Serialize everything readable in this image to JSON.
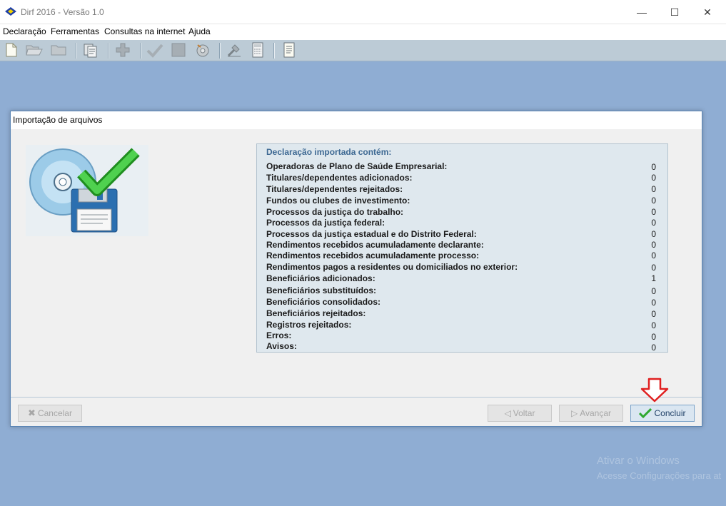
{
  "window": {
    "title": "Dirf 2016 - Versão 1.0"
  },
  "menu": [
    "Declaração",
    "Ferramentas",
    "Consultas na internet",
    "Ajuda"
  ],
  "toolbar": {
    "icons": [
      "new-document-icon",
      "open-folder-icon",
      "folder-icon",
      "copy-pages-icon",
      "add-icon",
      "check-icon",
      "stop-icon",
      "search-icon",
      "edit-icon",
      "calculator-icon",
      "report-icon"
    ]
  },
  "dialog": {
    "title": "Importação de arquivos",
    "summary_title": "Declaração importada contém:",
    "rows": [
      {
        "label": "Operadoras de Plano de Saúde Empresarial:",
        "value": "0"
      },
      {
        "label": "Titulares/dependentes adicionados:",
        "value": "0"
      },
      {
        "label": "Titulares/dependentes rejeitados:",
        "value": "0"
      },
      {
        "label": "Fundos ou clubes de investimento:",
        "value": "0"
      },
      {
        "label": "Processos da justiça do trabalho:",
        "value": "0"
      },
      {
        "label": "Processos da justiça federal:",
        "value": "0"
      },
      {
        "label": "Processos da justiça estadual e do Distrito Federal:",
        "value": "0"
      },
      {
        "label": "Rendimentos recebidos acumuladamente declarante:",
        "value": "0"
      },
      {
        "label": "Rendimentos recebidos acumuladamente processo:",
        "value": "0"
      },
      {
        "label": "Rendimentos pagos a residentes ou domiciliados no exterior:",
        "value": "0"
      },
      {
        "label": "Beneficiários adicionados:",
        "value": "1"
      },
      {
        "label": "Beneficiários substituídos:",
        "value": "0"
      },
      {
        "label": "Beneficiários consolidados:",
        "value": "0"
      },
      {
        "label": "Beneficiários rejeitados:",
        "value": "0"
      },
      {
        "label": "Registros rejeitados:",
        "value": "0"
      },
      {
        "label": "Erros:",
        "value": "0"
      },
      {
        "label": "Avisos:",
        "value": "0"
      }
    ],
    "buttons": {
      "cancel": "Cancelar",
      "back": "Voltar",
      "next": "Avançar",
      "finish": "Concluir"
    }
  },
  "watermark": {
    "line1": "Ativar o Windows",
    "line2": "Acesse Configurações para ativar o Windows."
  },
  "colors": {
    "desktop": "#8fadd3",
    "accent": "#3e6993",
    "arrow": "#e02020",
    "check": "#2fa82f"
  }
}
